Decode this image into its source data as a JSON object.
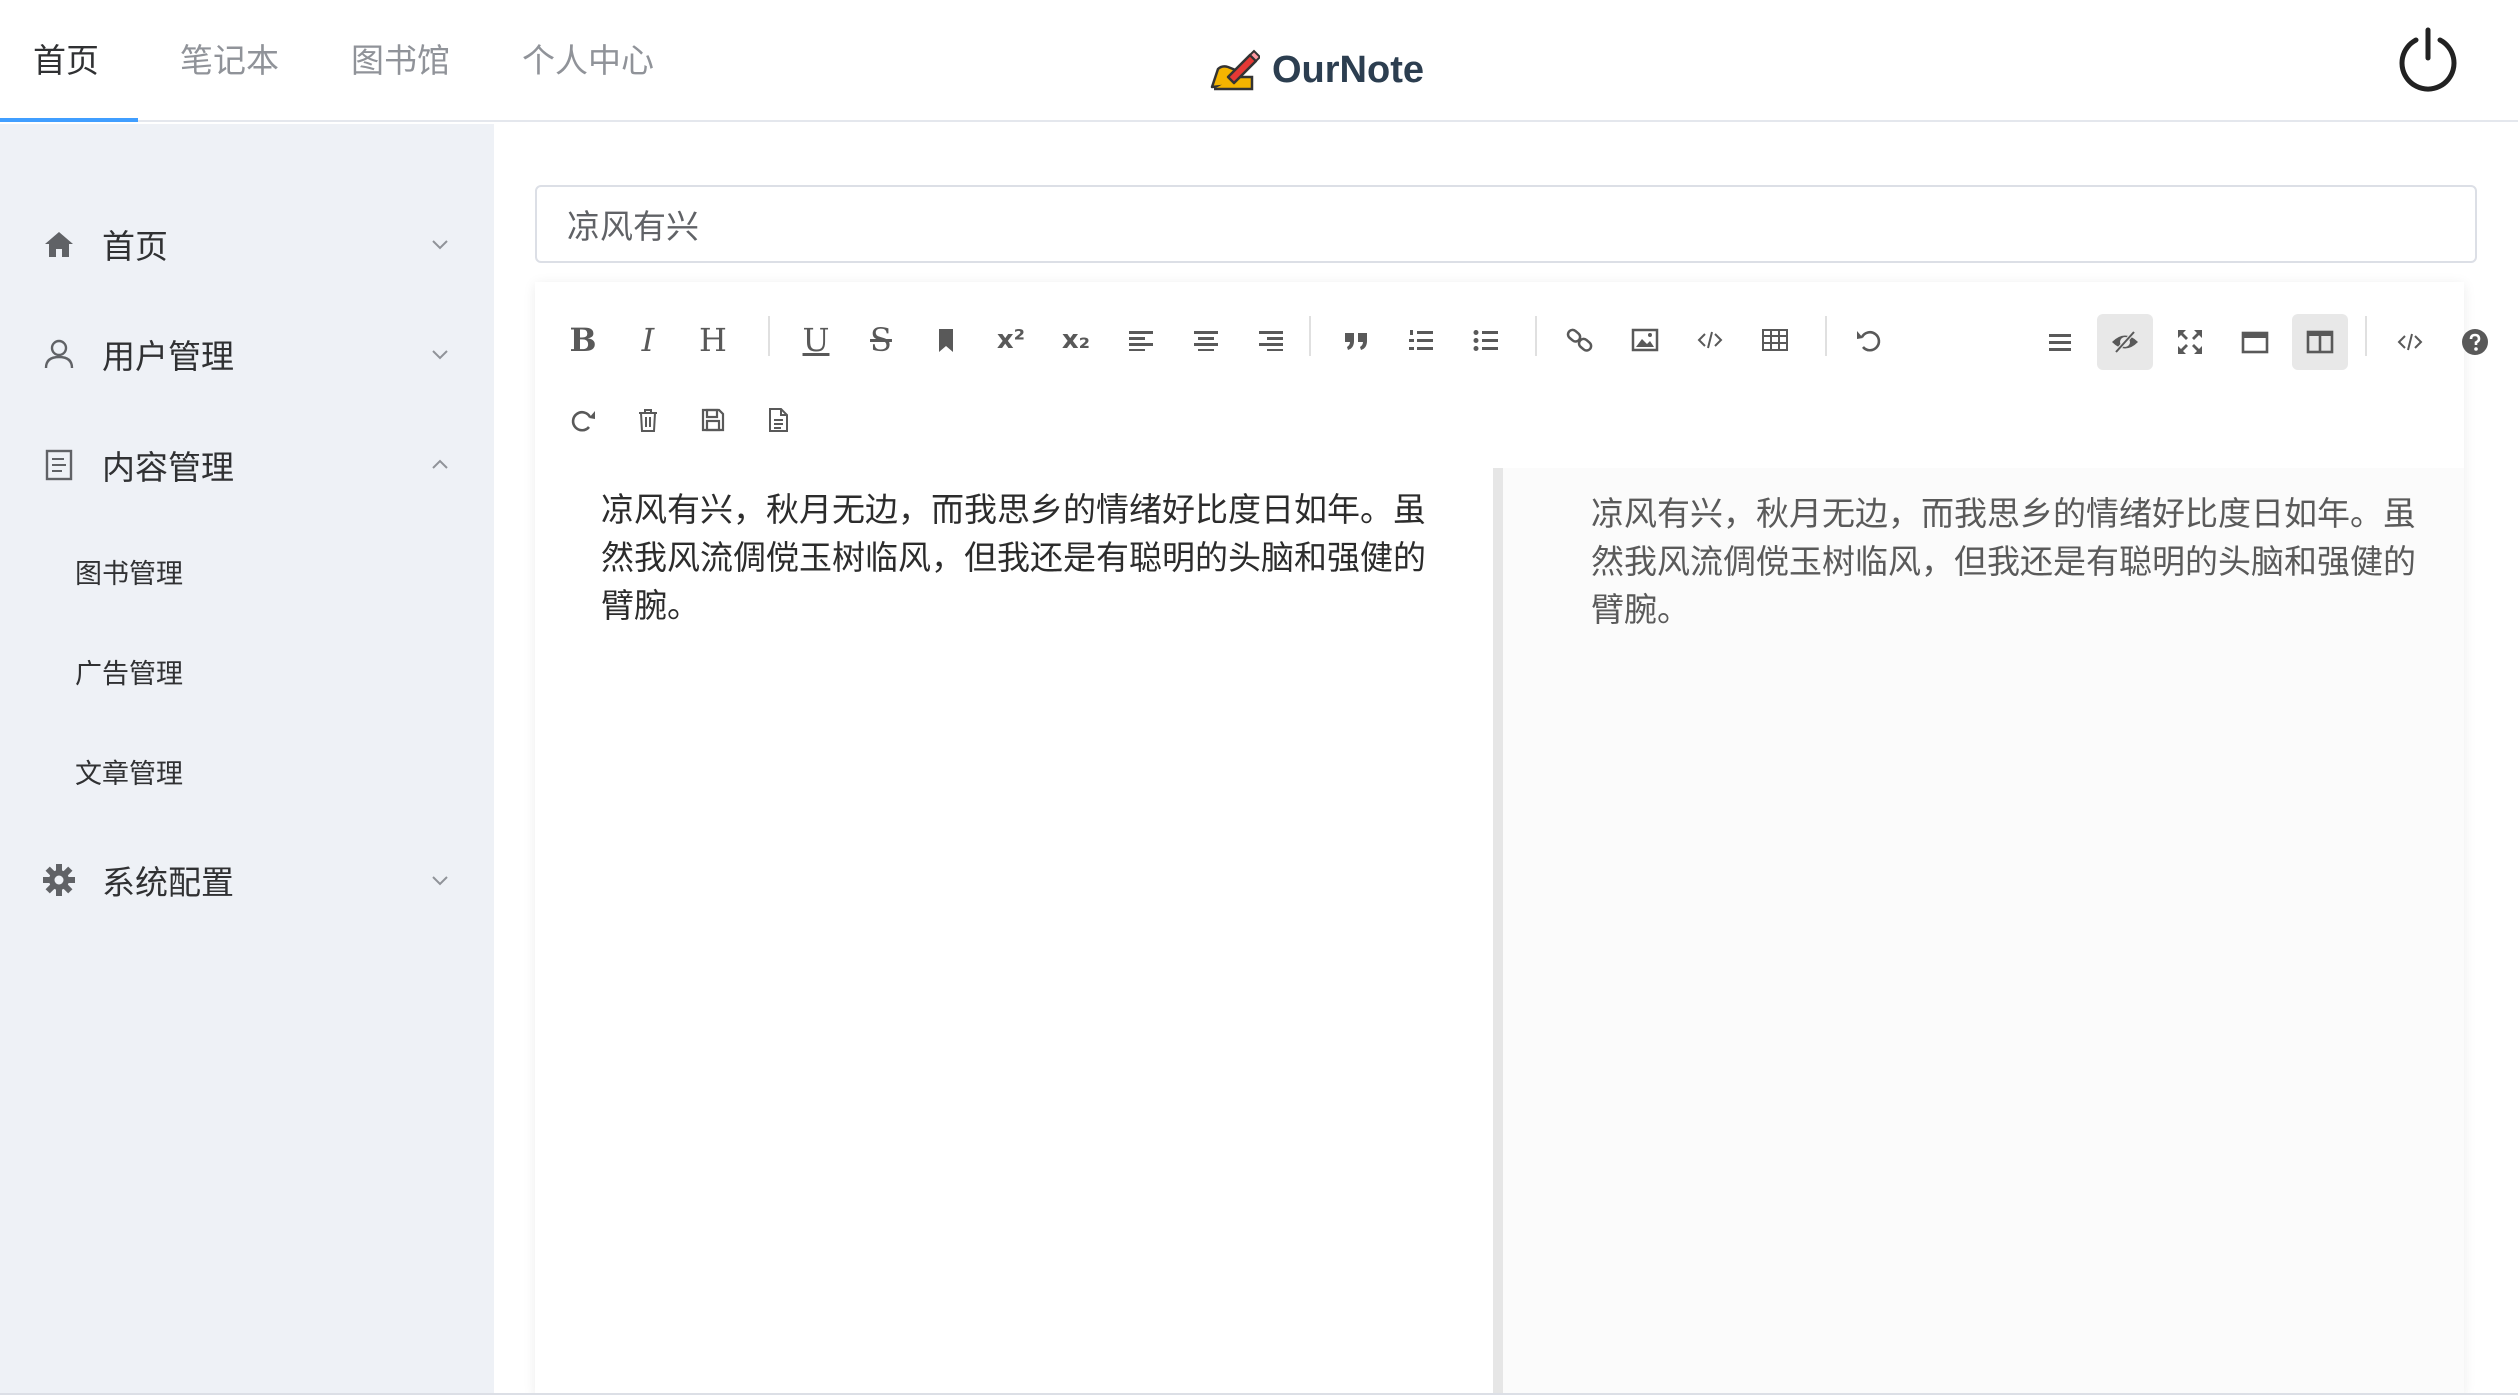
{
  "header": {
    "tabs": [
      {
        "label": "首页",
        "active": true
      },
      {
        "label": "笔记本"
      },
      {
        "label": "图书馆"
      },
      {
        "label": "个人中心"
      }
    ],
    "brand": "OurNote",
    "accent_color": "#409eff",
    "power_icon": "power-icon"
  },
  "sidebar": {
    "items": [
      {
        "label": "首页",
        "icon": "home-icon",
        "expanded": false
      },
      {
        "label": "用户管理",
        "icon": "user-icon",
        "expanded": false
      },
      {
        "label": "内容管理",
        "icon": "document-icon",
        "expanded": true,
        "children": [
          {
            "label": "图书管理"
          },
          {
            "label": "广告管理"
          },
          {
            "label": "文章管理"
          }
        ]
      },
      {
        "label": "系统配置",
        "icon": "gear-icon",
        "expanded": false
      }
    ]
  },
  "editor": {
    "title_value": "凉风有兴",
    "content": "凉风有兴，秋月无边，而我思乡的情绪好比度日如年。虽然我风流倜傥玉树临风，但我还是有聪明的头脑和强健的臂腕。",
    "preview": "凉风有兴，秋月无边，而我思乡的情绪好比度日如年。虽然我风流倜傥玉树临风，但我还是有聪明的头脑和强健的臂腕。",
    "toolbar": {
      "bold": "B",
      "italic": "I",
      "header": "H",
      "underline": "U",
      "strikethrough": "S",
      "superscript": "x²",
      "subscript": "x₂"
    }
  }
}
